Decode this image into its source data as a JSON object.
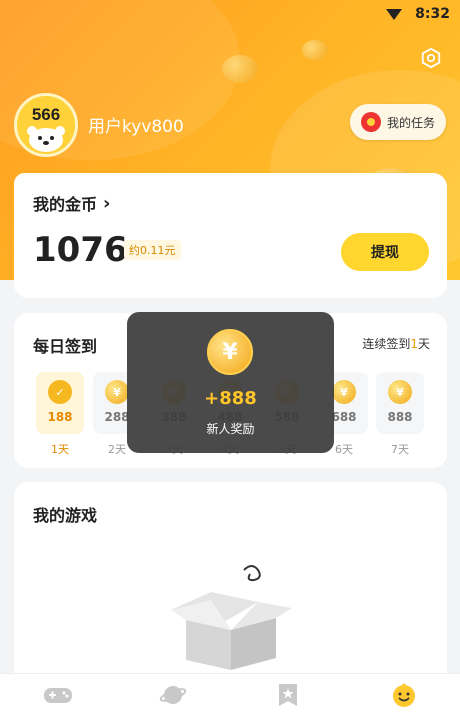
{
  "status_bar": {
    "time": "8:32"
  },
  "user": {
    "username": "用户kyv800",
    "avatar_text": "566"
  },
  "task_button": {
    "label": "我的任务"
  },
  "coins": {
    "title": "我的金币",
    "value": "1076",
    "approx": "约0.11元",
    "withdraw_label": "提现"
  },
  "signin": {
    "title": "每日签到",
    "streak_prefix": "连续签到",
    "streak_days": "1",
    "streak_suffix": "天",
    "days": [
      {
        "value": "188",
        "label": "1天",
        "active": true
      },
      {
        "value": "288",
        "label": "2天",
        "active": false
      },
      {
        "value": "388",
        "label": "3天",
        "active": false
      },
      {
        "value": "488",
        "label": "4天",
        "active": false
      },
      {
        "value": "588",
        "label": "5天",
        "active": false
      },
      {
        "value": "688",
        "label": "6天",
        "active": false
      },
      {
        "value": "888",
        "label": "7天",
        "active": false
      }
    ]
  },
  "games": {
    "title": "我的游戏"
  },
  "popup": {
    "amount": "+888",
    "label": "新人奖励",
    "coin_symbol": "¥"
  },
  "bottom_nav": [
    {
      "icon": "gamepad-icon"
    },
    {
      "icon": "planet-icon"
    },
    {
      "icon": "star-card-icon"
    },
    {
      "icon": "smiley-icon"
    }
  ],
  "colors": {
    "accent": "#ffd62e",
    "brand_orange": "#ff9a1f",
    "coin_gold": "#f3a515"
  }
}
